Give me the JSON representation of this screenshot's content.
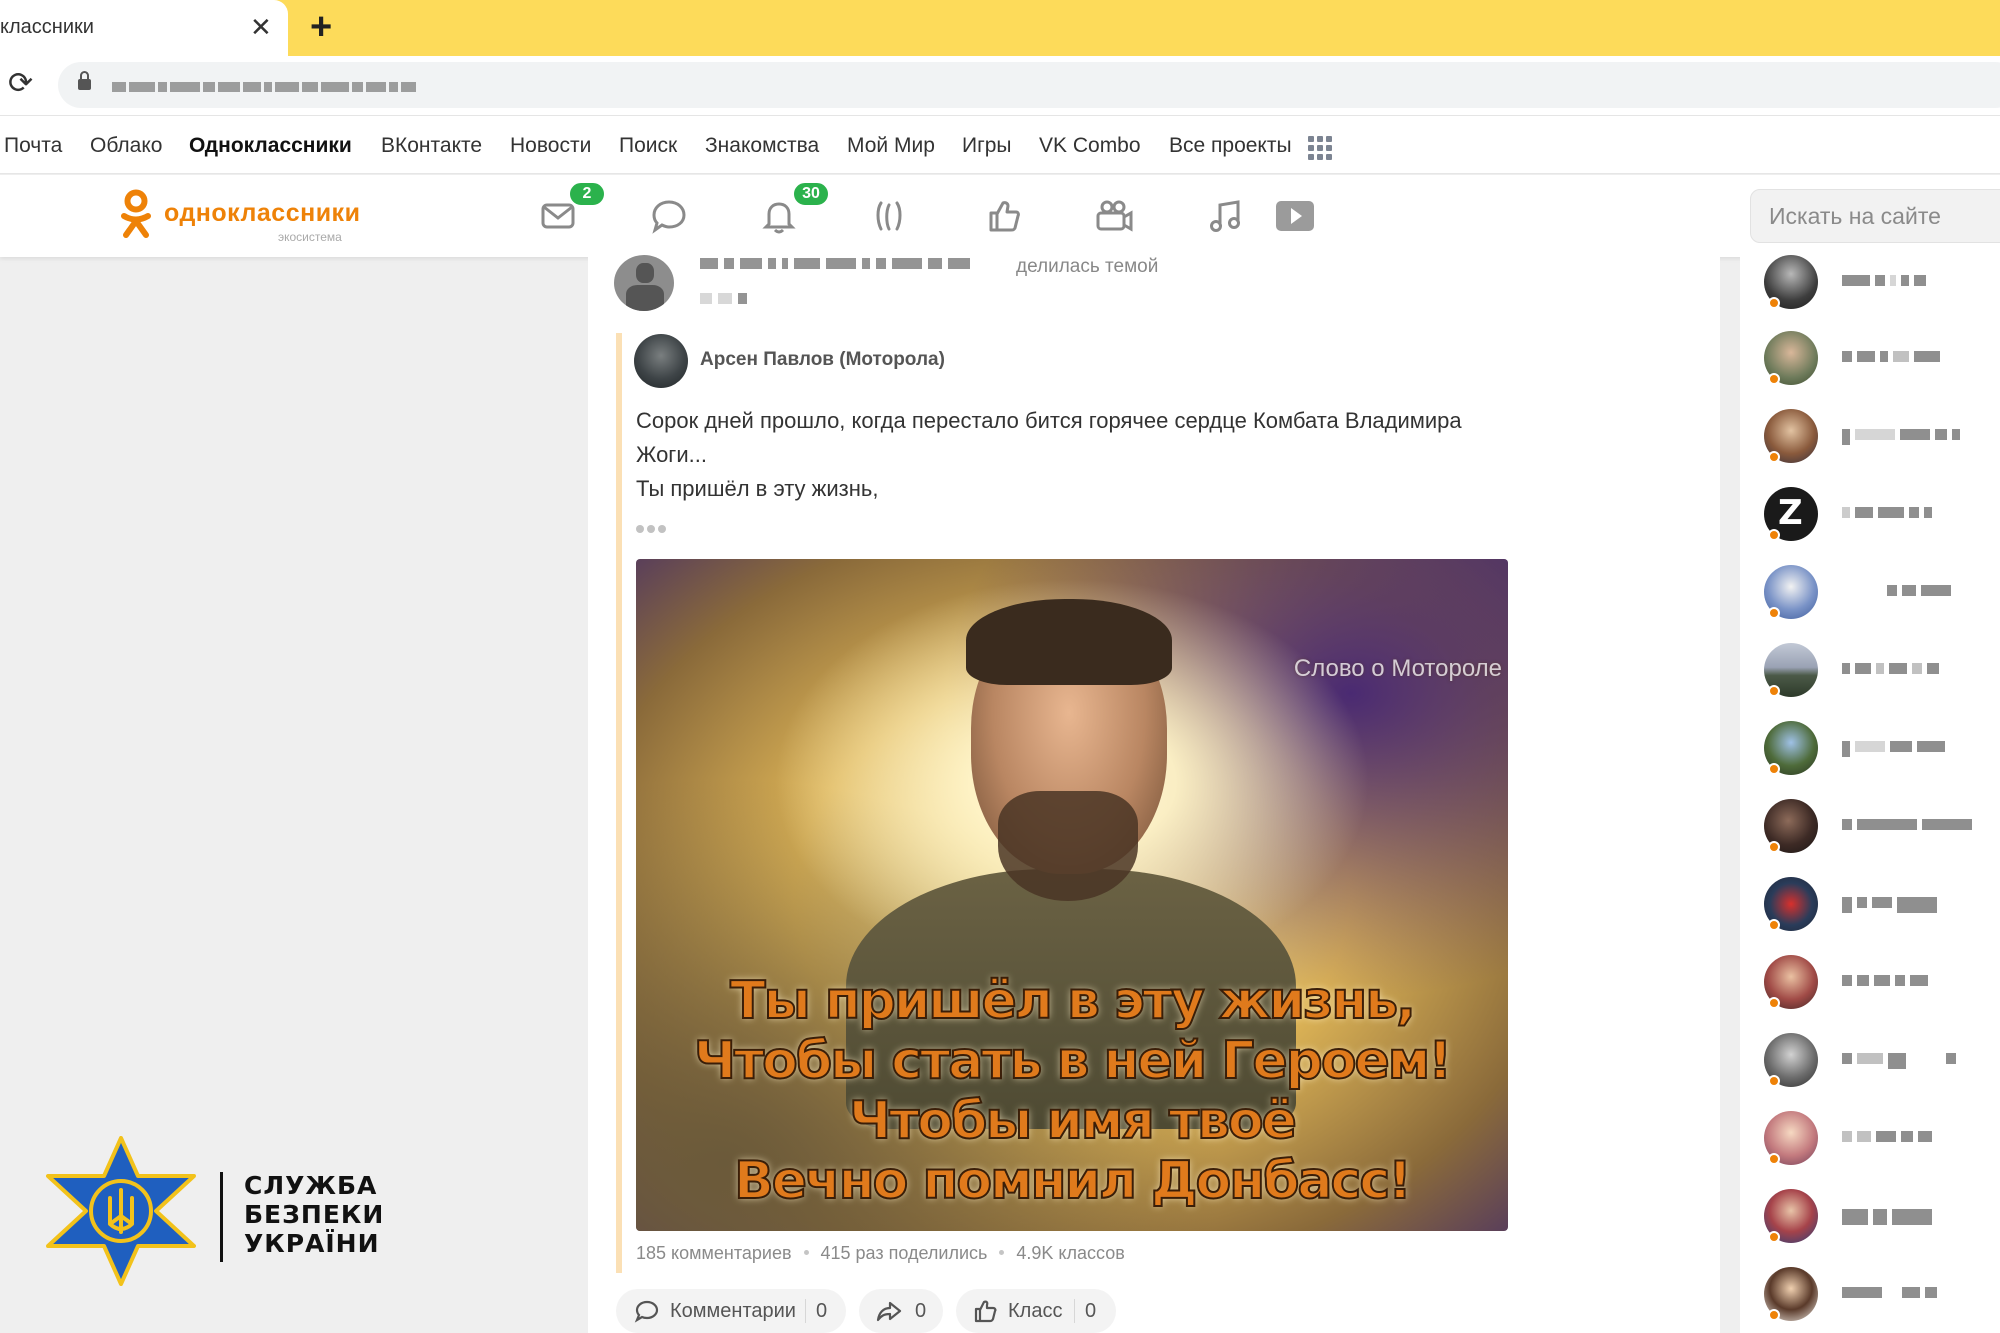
{
  "browser": {
    "tab_title": "классники",
    "tab_close": "✕",
    "new_tab": "+",
    "reload": "⟳"
  },
  "projects": [
    {
      "label": "Почта",
      "bold": false
    },
    {
      "label": "Облако",
      "bold": false
    },
    {
      "label": "Одноклассники",
      "bold": true
    },
    {
      "label": "ВКонтакте",
      "bold": false
    },
    {
      "label": "Новости",
      "bold": false
    },
    {
      "label": "Поиск",
      "bold": false
    },
    {
      "label": "Знакомства",
      "bold": false
    },
    {
      "label": "Мой Мир",
      "bold": false
    },
    {
      "label": "Игры",
      "bold": false
    },
    {
      "label": "VK Combo",
      "bold": false
    },
    {
      "label": "Все проекты",
      "bold": false
    }
  ],
  "ok": {
    "logo_text": "одноклассники",
    "logo_sub": "экосистема",
    "brand_color": "#ee8208",
    "nav": [
      {
        "icon": "messages-icon",
        "badge": "2"
      },
      {
        "icon": "discussions-icon",
        "badge": null
      },
      {
        "icon": "notifications-icon",
        "badge": "30"
      },
      {
        "icon": "guests-icon",
        "badge": null
      },
      {
        "icon": "events-like-icon",
        "badge": null
      },
      {
        "icon": "video-camera-icon",
        "badge": null
      },
      {
        "icon": "music-icon",
        "badge": null
      },
      {
        "icon": "video-play-icon",
        "badge": null
      }
    ],
    "badge_color": "#2bb24c",
    "search_placeholder": "Искать на сайте"
  },
  "post": {
    "shared_label": "делилась темой",
    "author": "Арсен Павлов (Моторола)",
    "text_lines": [
      "Сорок дней прошло, когда перестало бится горячее сердце Комбата Владимира",
      "Жоги...",
      "Ты пришёл в эту жизнь,"
    ],
    "image_watermark": "Слово о Моторолe",
    "image_caption": [
      "Ты пришёл в эту жизнь,",
      "Чтобы стать в ней Героем!",
      "Чтобы имя твоё",
      "Вечно помнил Донбасс!"
    ],
    "stats": {
      "comments": "185 комментариев",
      "shares": "415 раз поделились",
      "likes": "4.9K классов"
    },
    "actions": {
      "comment_label": "Комментарии",
      "comment_count": "0",
      "share_count": "0",
      "like_label": "Класс",
      "like_count": "0"
    }
  },
  "sbu": {
    "line1": "СЛУЖБА",
    "line2": "БЕЗПЕКИ",
    "line3": "УКРАЇНИ",
    "emblem_blue": "#1f5fbf",
    "emblem_gold": "#f2c21b"
  }
}
